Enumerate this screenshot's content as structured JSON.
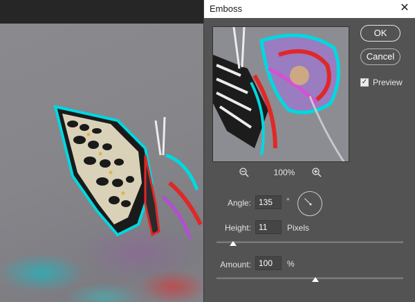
{
  "dialog": {
    "title": "Emboss",
    "close_glyph": "✕",
    "ok_label": "OK",
    "cancel_label": "Cancel",
    "preview_label": "Preview",
    "preview_checked": true
  },
  "zoom": {
    "level": "100%",
    "zoom_out_icon": "zoom-out-icon",
    "zoom_in_icon": "zoom-in-icon"
  },
  "controls": {
    "angle_label": "Angle:",
    "angle_value": "135",
    "angle_unit": "°",
    "height_label": "Height:",
    "height_value": "11",
    "height_unit": "Pixels",
    "amount_label": "Amount:",
    "amount_value": "100",
    "amount_unit": "%",
    "height_slider_fraction": 0.09,
    "amount_slider_fraction": 0.53
  },
  "colors": {
    "dialog_bg": "#535353",
    "titlebar_bg": "#ffffff",
    "emboss_cyan": "#00d8e0",
    "emboss_red": "#e02828"
  }
}
